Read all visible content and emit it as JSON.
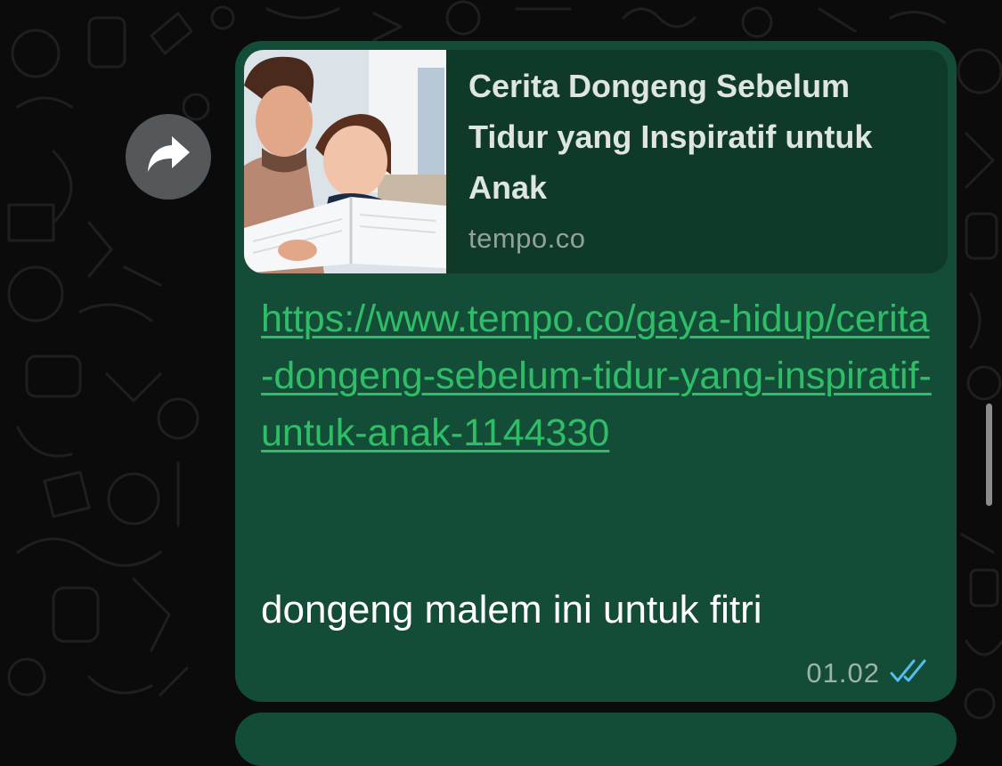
{
  "link_preview": {
    "title": "Cerita Dongeng Sebelum Tidur yang Inspiratif untuk Anak",
    "domain": "tempo.co",
    "thumbnail": "parent-reading-to-child-photo"
  },
  "message": {
    "url": "https://www.tempo.co/gaya-hidup/cerita-dongeng-sebelum-tidur-yang-inspiratif-untuk-anak-1144330",
    "text": "dongeng malem ini untuk fitri",
    "time": "01.02",
    "status": "read"
  },
  "icons": {
    "forward": "forward-arrow-icon",
    "read_receipt": "double-check-icon"
  },
  "colors": {
    "bubble": "#144d37",
    "preview_card": "#0f3a28",
    "link": "#2fbd67",
    "read_check": "#53bdeb",
    "background": "#0b0b0b"
  }
}
